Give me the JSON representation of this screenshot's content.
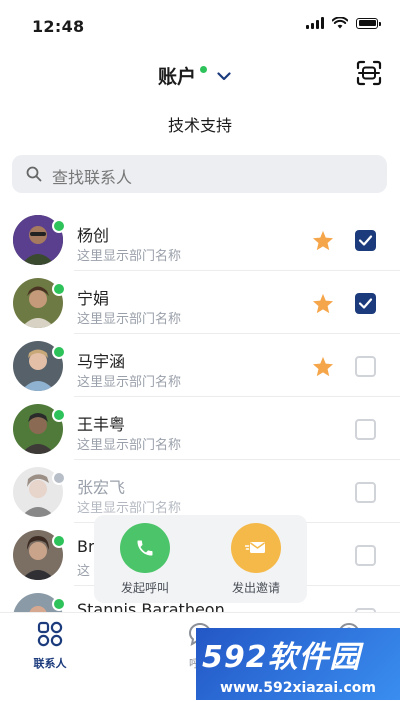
{
  "status_bar": {
    "time": "12:48"
  },
  "header": {
    "title": "账户"
  },
  "section_title": "技术支持",
  "search": {
    "placeholder": "查找联系人"
  },
  "contacts": [
    {
      "name": "杨创",
      "dept": "这里显示部门名称",
      "presence": "online",
      "starred": true,
      "checked": true
    },
    {
      "name": "宁娟",
      "dept": "这里显示部门名称",
      "presence": "online",
      "starred": true,
      "checked": true
    },
    {
      "name": "马宇涵",
      "dept": "这里显示部门名称",
      "presence": "online",
      "starred": true,
      "checked": false
    },
    {
      "name": "王丰粤",
      "dept": "这里显示部门名称",
      "presence": "online",
      "starred": false,
      "checked": false
    },
    {
      "name": "张宏飞",
      "dept": "这里显示部门名称",
      "presence": "offline",
      "starred": false,
      "checked": false
    },
    {
      "name": "Br",
      "dept": "这",
      "presence": "online",
      "starred": false,
      "checked": false
    },
    {
      "name": "Stannis Baratheon",
      "dept": "",
      "presence": "online",
      "starred": false,
      "checked": false
    }
  ],
  "action_popup": {
    "call_label": "发起呼叫",
    "invite_label": "发出邀请"
  },
  "tabbar": {
    "contacts_label": "联系人",
    "calls_label": "呼叫"
  },
  "watermark": {
    "brand": "592软件园",
    "url": "www.592xiazai.com"
  },
  "colors": {
    "accent": "#1c3b7d",
    "online": "#2ec25a",
    "offline": "#b8bec8",
    "star": "#f5a64a",
    "call": "#4cc56a",
    "invite": "#f5b94a"
  }
}
